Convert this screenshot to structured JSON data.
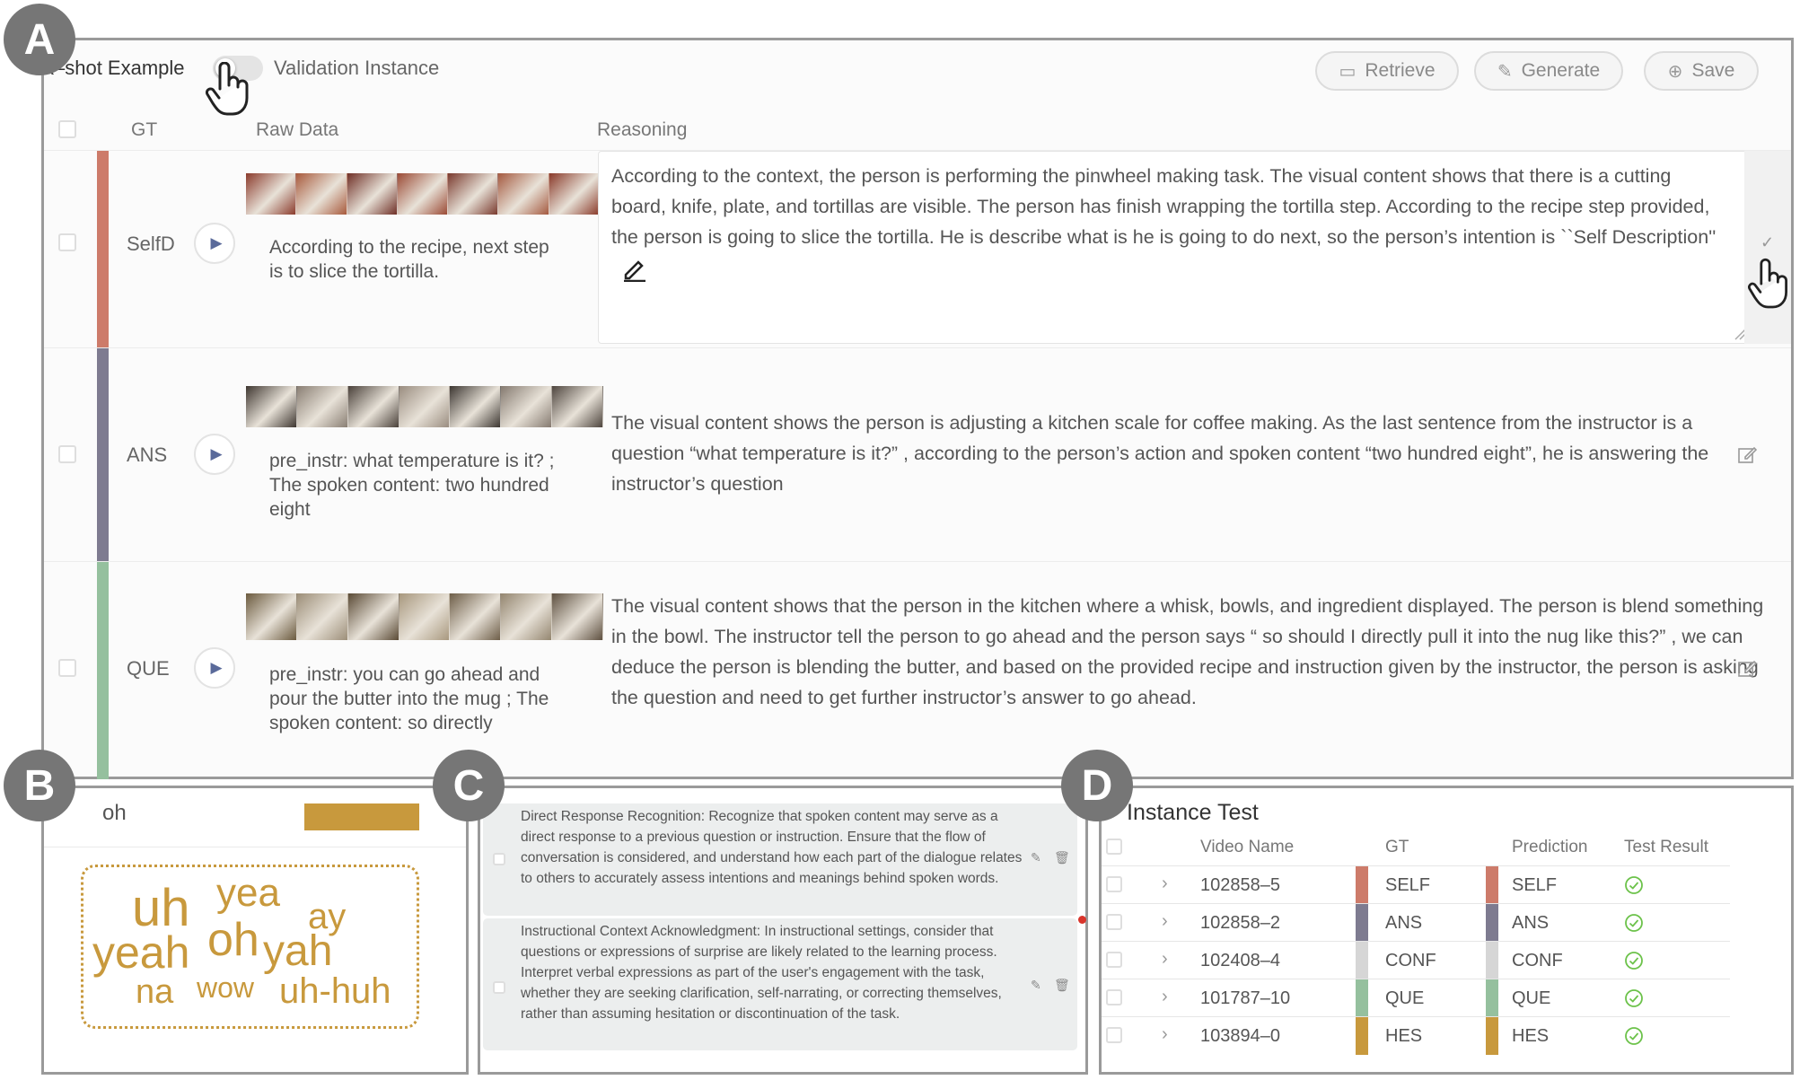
{
  "badges": {
    "a": "A",
    "b": "B",
    "c": "C",
    "d": "D"
  },
  "panel_a": {
    "mode_left": "k–shot Example",
    "mode_right": "Validation Instance",
    "buttons": {
      "retrieve": "Retrieve",
      "generate": "Generate",
      "save": "Save"
    },
    "columns": {
      "gt": "GT",
      "raw": "Raw Data",
      "reasoning": "Reasoning"
    },
    "rows": [
      {
        "gt": "SelfD",
        "color": "#cd7b6a",
        "raw_text": "According to the recipe, next step is to slice the tortilla.",
        "reasoning": "According to the context, the person is performing the pinwheel making task. The visual content shows that there is a cutting board, knife, plate, and tortillas are visible. The person has finish wrapping the tortilla step. According to the recipe step provided, the person is going to slice the tortilla. He is describe what is he is going to do next, so the person’s intention is ``Self Description''"
      },
      {
        "gt": "ANS",
        "color": "#7e7b90",
        "raw_text": "pre_instr: what temperature is it? ; The spoken content: two hundred eight",
        "reasoning": "The visual content shows the person is adjusting a kitchen scale for coffee making. As the last sentence from the instructor is a question “what temperature is it?” , according to the person’s action and spoken content “two hundred eight”, he is answering the instructor’s question"
      },
      {
        "gt": "QUE",
        "color": "#95c09e",
        "raw_text": "pre_instr: you can go ahead and pour the butter into the mug ; The spoken content: so directly",
        "reasoning": "The visual content shows that the person in the kitchen where a whisk, bowls, and ingredient displayed. The person is blend something in the bowl. The instructor tell the person to go ahead and the person says “ so should I directly pull it into the nug like this?” , we can deduce the person is blending the butter, and based on the provided recipe and instruction given by the instructor, the person is asking the question and need to get further instructor’s answer to go ahead."
      }
    ],
    "frame_colors": {
      "row0": [
        "#8b3b2c",
        "#a85a3c",
        "#6f2f26",
        "#9b4a35",
        "#7a3a2e",
        "#a55a40",
        "#8a3a2a"
      ],
      "row1": [
        "#3e3630",
        "#8a7f74",
        "#4a413a",
        "#9a8d80",
        "#3c3631",
        "#857a70",
        "#4e453e"
      ],
      "row2": [
        "#6b5a3e",
        "#9c8e78",
        "#5a4a35",
        "#a8987e",
        "#6e5e48",
        "#948670",
        "#5e5040"
      ]
    }
  },
  "panel_b": {
    "search_value": "oh",
    "swatch_color": "#c8993d",
    "cloud_words": [
      "uh",
      "yea",
      "ay",
      "yeah",
      "oh",
      "yah",
      "na",
      "wow",
      "uh-huh"
    ]
  },
  "panel_c": {
    "rules": [
      "Direct Response Recognition: Recognize that spoken content may serve as a direct response to a previous question or instruction. Ensure that the flow of conversation is considered, and understand how each part of the dialogue relates to others to accurately assess intentions and meanings behind spoken words.",
      "Instructional Context Acknowledgment: In instructional settings, consider that questions or expressions of surprise are likely related to the learning process. Interpret verbal expressions as part of the user's engagement with the task, whether they are seeking clarification, self-narrating, or correcting themselves, rather than assuming hesitation or discontinuation of the task."
    ]
  },
  "panel_d": {
    "title": "Instance Test",
    "headers": {
      "video": "Video Name",
      "gt": "GT",
      "pred": "Prediction",
      "result": "Test Result"
    },
    "rows": [
      {
        "video": "102858–5",
        "gt": "SELF",
        "pred": "SELF",
        "gt_color": "#cd7b6a",
        "pred_color": "#cd7b6a"
      },
      {
        "video": "102858–2",
        "gt": "ANS",
        "pred": "ANS",
        "gt_color": "#7e7b90",
        "pred_color": "#7e7b90"
      },
      {
        "video": "102408–4",
        "gt": "CONF",
        "pred": "CONF",
        "gt_color": "#d6d6d6",
        "pred_color": "#d6d6d6"
      },
      {
        "video": "101787–10",
        "gt": "QUE",
        "pred": "QUE",
        "gt_color": "#95c09e",
        "pred_color": "#95c09e"
      },
      {
        "video": "103894–0",
        "gt": "HES",
        "pred": "HES",
        "gt_color": "#c8993d",
        "pred_color": "#c8993d"
      }
    ],
    "result_icon": "check-circle-icon",
    "result_color": "#6cc24a"
  }
}
